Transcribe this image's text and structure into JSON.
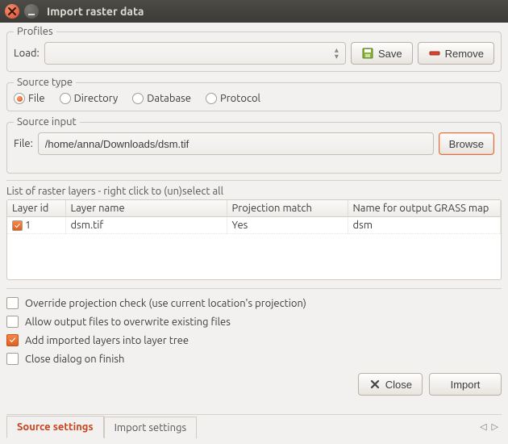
{
  "window": {
    "title": "Import raster data"
  },
  "profiles": {
    "legend": "Profiles",
    "load_label": "Load:",
    "save_label": "Save",
    "remove_label": "Remove"
  },
  "source_type": {
    "legend": "Source type",
    "options": {
      "file": "File",
      "directory": "Directory",
      "database": "Database",
      "protocol": "Protocol"
    },
    "selected": "file"
  },
  "source_input": {
    "legend": "Source input",
    "file_label": "File:",
    "file_value": "/home/anna/Downloads/dsm.tif",
    "browse_label": "Browse"
  },
  "layer_list": {
    "caption": "List of raster layers - right click to (un)select all",
    "headers": {
      "layer_id": "Layer id",
      "layer_name": "Layer name",
      "projection": "Projection match",
      "output_name": "Name for output GRASS map"
    },
    "rows": [
      {
        "checked": true,
        "id": "1",
        "name": "dsm.tif",
        "projection": "Yes",
        "output": "dsm"
      }
    ]
  },
  "options": {
    "override": "Override projection check (use current location's projection)",
    "overwrite": "Allow output files to overwrite existing files",
    "add_tree": "Add imported layers into layer tree",
    "close_finish": "Close dialog on finish"
  },
  "buttons": {
    "close": "Close",
    "import": "Import"
  },
  "tabs": {
    "source": "Source settings",
    "import": "Import settings"
  }
}
